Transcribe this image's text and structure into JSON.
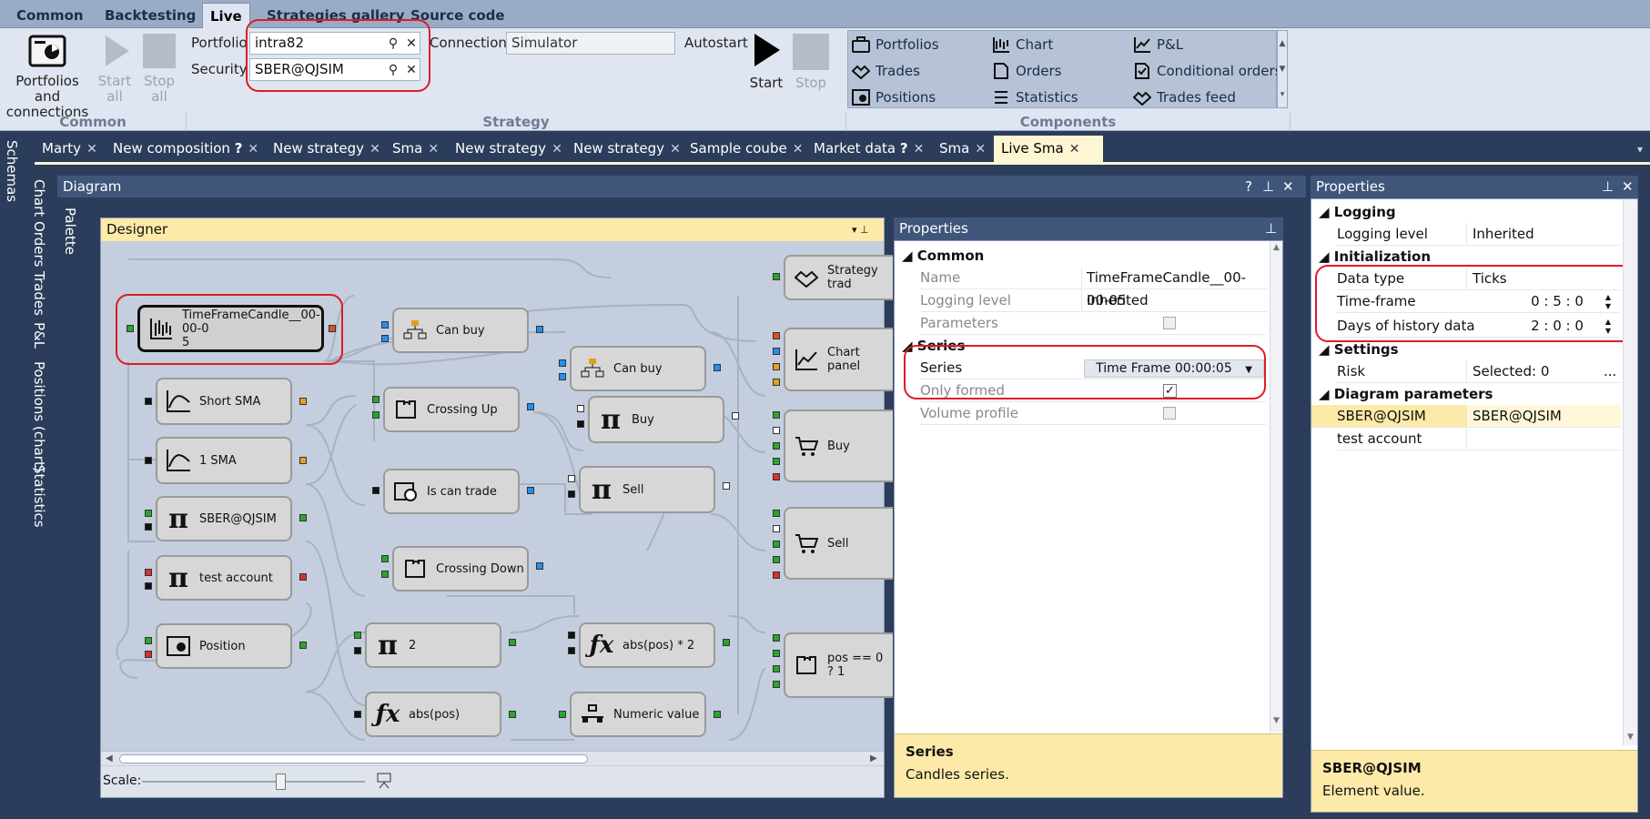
{
  "menu": {
    "tabs": [
      "Common",
      "Backtesting",
      "Live",
      "Strategies gallery",
      "Source code"
    ]
  },
  "ribbon": {
    "common": {
      "portfolios_label_1": "Portfolios and",
      "portfolios_label_2": "connections",
      "start_all_1": "Start",
      "start_all_2": "all",
      "stop_all_1": "Stop",
      "stop_all_2": "all",
      "group": "Common"
    },
    "strategy": {
      "portfolio_label": "Portfolio",
      "portfolio_value": "intra82",
      "security_label": "Security",
      "security_value": "SBER@QJSIM",
      "connection_label": "Connection",
      "connection_value": "Simulator",
      "autostart_label": "Autostart",
      "start": "Start",
      "stop": "Stop",
      "group": "Strategy"
    },
    "components": {
      "items": [
        "Portfolios",
        "Trades",
        "Positions",
        "Chart",
        "Orders",
        "Statistics",
        "P&L",
        "Conditional orders",
        "Trades feed"
      ],
      "group": "Components"
    }
  },
  "left_strip": [
    "Schemas"
  ],
  "side_strip": [
    "Chart",
    "Orders",
    "Trades",
    "P&L",
    "Positions (chart)",
    "Statistics"
  ],
  "doc_tabs": [
    {
      "label": "Marty",
      "q": ""
    },
    {
      "label": "New composition",
      "q": "?"
    },
    {
      "label": "New strategy",
      "q": ""
    },
    {
      "label": "Sma",
      "q": ""
    },
    {
      "label": "New strategy",
      "q": ""
    },
    {
      "label": "New strategy",
      "q": ""
    },
    {
      "label": "Sample coube",
      "q": ""
    },
    {
      "label": "Market data",
      "q": "?"
    },
    {
      "label": "Sma",
      "q": ""
    },
    {
      "label": "Live Sma",
      "q": ""
    }
  ],
  "diagram": {
    "title": "Diagram",
    "palette": "Palette",
    "designer_title": "Designer",
    "scale_label": "Scale:",
    "nodes": {
      "tfc_1": "TimeFrameCandle__00-00-0",
      "tfc_2": "5",
      "short_sma": "Short SMA",
      "one_sma": "1 SMA",
      "sber": "SBER@QJSIM",
      "test_account": "test account",
      "position": "Position",
      "can_buy_1": "Can buy",
      "can_buy_2": "Can buy",
      "crossing_up": "Crossing Up",
      "is_can_trade": "Is can trade",
      "crossing_down": "Crossing Down",
      "buy_pi": "Buy",
      "sell_pi": "Sell",
      "pi_2": "2",
      "abs_pos": "abs(pos)",
      "abs_pos_2": "abs(pos) * 2",
      "numeric_value": "Numeric value",
      "strategy_trades": "Strategy trad",
      "chart_panel": "Chart panel",
      "buy": "Buy",
      "sell": "Sell",
      "pos_expr": "pos == 0 ? 1"
    }
  },
  "props1": {
    "title": "Properties",
    "common": "Common",
    "name_label": "Name",
    "name_value": "TimeFrameCandle__00-00-05",
    "logging_label": "Logging level",
    "logging_value": "Inherited",
    "parameters_label": "Parameters",
    "series_cat": "Series",
    "series_label": "Series",
    "series_value": "Time Frame 00:00:05",
    "only_formed_label": "Only formed",
    "only_formed_check": "✓",
    "volume_profile_label": "Volume profile",
    "desc_title": "Series",
    "desc_text": "Candles series."
  },
  "props2": {
    "title": "Properties",
    "logging_cat": "Logging",
    "logging_label": "Logging level",
    "logging_value": "Inherited",
    "init_cat": "Initialization",
    "data_type_label": "Data type",
    "data_type_value": "Ticks",
    "timeframe_label": "Time-frame",
    "timeframe_value": "0 : 5 : 0",
    "days_label": "Days of history data",
    "days_value": "2 : 0 : 0",
    "settings_cat": "Settings",
    "risk_label": "Risk",
    "risk_value": "Selected: 0",
    "risk_more": "...",
    "diag_cat": "Diagram parameters",
    "sber_label": "SBER@QJSIM",
    "sber_value": "SBER@QJSIM",
    "test_account_label": "test account",
    "test_account_value": "",
    "desc_title": "SBER@QJSIM",
    "desc_text": "Element value."
  }
}
